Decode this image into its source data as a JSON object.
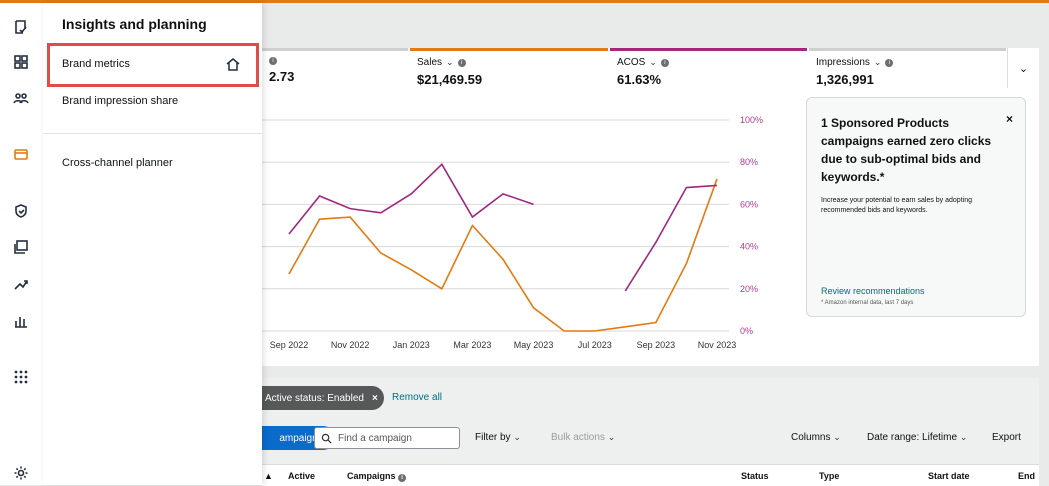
{
  "flyout": {
    "title": "Insights and planning",
    "items": [
      {
        "label": "Brand metrics"
      },
      {
        "label": "Brand impression share"
      },
      {
        "label": "Cross-channel planner"
      }
    ]
  },
  "metrics": [
    {
      "label": "",
      "value": "2.73"
    },
    {
      "label": "Sales",
      "value": "$21,469.59"
    },
    {
      "label": "ACOS",
      "value": "61.63%"
    },
    {
      "label": "Impressions",
      "value": "1,326,991"
    }
  ],
  "colors": {
    "sales": "#e47911",
    "acos": "#a0287f",
    "accent": "#0b6bcb"
  },
  "chart_data": {
    "type": "line",
    "x": [
      "Sep 2022",
      "Nov 2022",
      "Jan 2023",
      "Mar 2023",
      "May 2023",
      "Jul 2023",
      "Sep 2023",
      "Nov 2023"
    ],
    "right_ticks": [
      "100%",
      "80%",
      "60%",
      "40%",
      "20%",
      "0%"
    ],
    "series": [
      {
        "name": "Sales",
        "values": [
          27,
          53,
          54,
          37,
          29,
          20,
          50,
          34,
          11,
          0,
          0,
          2,
          4,
          32,
          72
        ]
      },
      {
        "name": "ACOS",
        "values": [
          46,
          64,
          58,
          56,
          65,
          79,
          54,
          65,
          60,
          null,
          null,
          19,
          42,
          68,
          69
        ]
      }
    ]
  },
  "recommendation": {
    "title": "1 Sponsored Products campaigns earned zero clicks due to sub-optimal bids and keywords.*",
    "desc": "Increase your potential to earn sales by adopting recommended bids and keywords.",
    "link": "Review recommendations",
    "note": "* Amazon internal data, last 7 days",
    "close": "×"
  },
  "filters": {
    "chip": "Active status: Enabled",
    "chip_x": "×",
    "remove_all": "Remove all",
    "create": "ampaign",
    "search_placeholder": "Find a campaign",
    "filter_by": "Filter by",
    "bulk": "Bulk actions",
    "columns": "Columns",
    "date_range": "Date range: Lifetime",
    "export": "Export"
  },
  "table": {
    "headers": [
      "Active",
      "Campaigns",
      "Status",
      "Type",
      "Start date",
      "End"
    ]
  }
}
